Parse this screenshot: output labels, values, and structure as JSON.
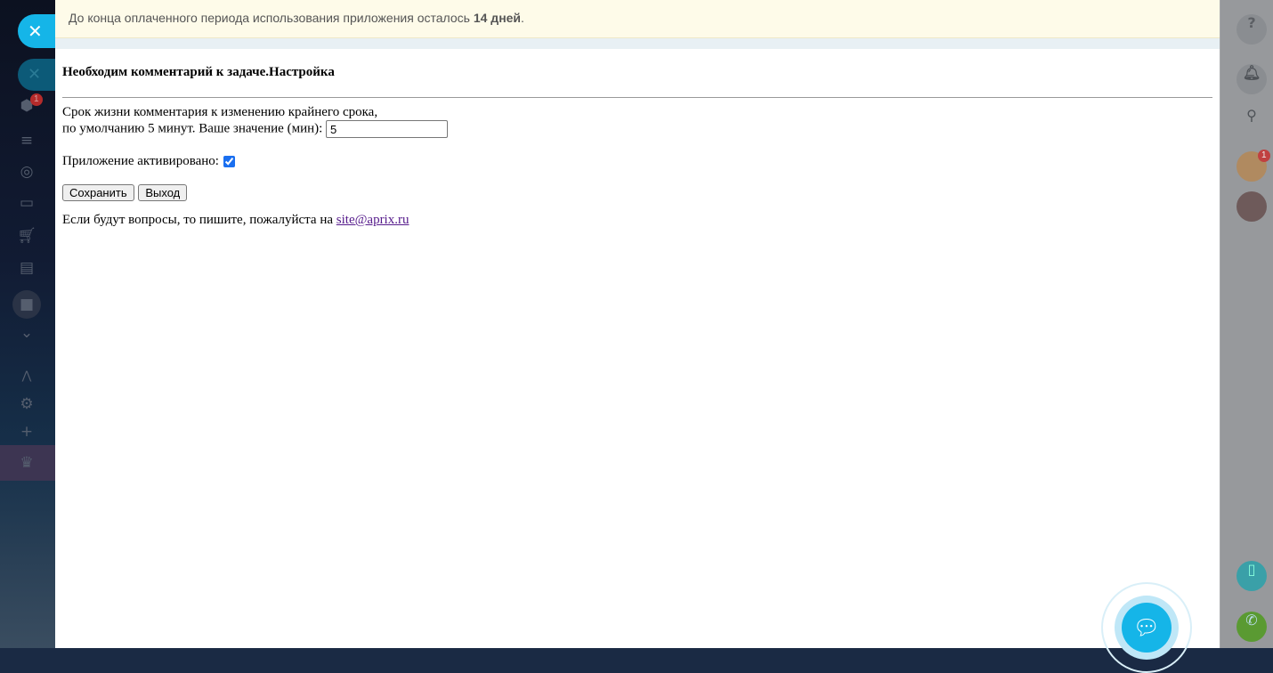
{
  "notice": {
    "text": "До конца оплаченного периода использования приложения осталось ",
    "days": "14 дней",
    "end": "."
  },
  "left_sidebar": {
    "badge": "1"
  },
  "right_sidebar": {
    "chat_badge": "1"
  },
  "settings": {
    "title": "Необходим комментарий к задаче.Настройка",
    "lifetime_line1": "Срок жизни комментария к изменению крайнего срока,",
    "lifetime_line2": "по умолчанию 5 минут. Ваше значение (мин):",
    "lifetime_value": "5",
    "activated_label": "Приложение активировано:",
    "activated": true,
    "save_label": "Сохранить",
    "exit_label": "Выход",
    "contact_text": "Если будут вопросы, то пишите, пожалуйста на ",
    "contact_email": "site@aprix.ru"
  },
  "colors": {
    "accent": "#15b5e8",
    "link": "#551a8b"
  }
}
